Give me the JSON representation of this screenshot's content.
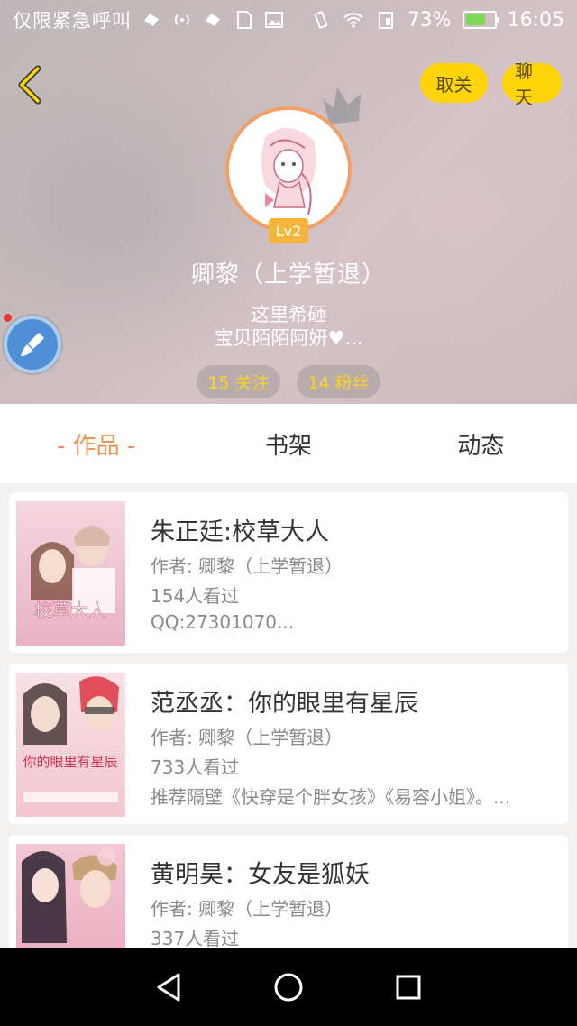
{
  "status_bar": {
    "carrier": "仅限紧急呼叫",
    "battery_percent": "73%",
    "battery_level": 0.73,
    "time": "16:05"
  },
  "header": {
    "back_icon": "chevron-left-icon",
    "unfollow_label": "取关",
    "chat_label": "聊天",
    "level": "Lv2",
    "username": "卿黎（上学暂退）",
    "bio_line1": "这里希砸",
    "bio_line2": "宝贝陌陌阿妍♥...",
    "follow_stat": "15 关注",
    "fans_stat": "14 粉丝"
  },
  "tabs": [
    {
      "label": "- 作品 -",
      "active": true
    },
    {
      "label": "书架",
      "active": false
    },
    {
      "label": "动态",
      "active": false
    }
  ],
  "works": [
    {
      "title": "朱正廷:校草大人",
      "author": "作者: 卿黎（上学暂退）",
      "views": "154人看过",
      "desc": "QQ:27301070...",
      "cover_text": "校草大人"
    },
    {
      "title": "范丞丞：你的眼里有星辰",
      "author": "作者: 卿黎（上学暂退）",
      "views": "733人看过",
      "desc": "推荐隔壁《快穿是个胖女孩》《易容小姐》。...",
      "cover_text": "你的眼里有星辰"
    },
    {
      "title": "黄明昊：女友是狐妖",
      "author": "作者: 卿黎（上学暂退）",
      "views": "337人看过",
      "desc": "",
      "cover_text": ""
    }
  ],
  "colors": {
    "accent": "#f09050",
    "yellow": "#ffd40a",
    "badge": "#f5b53a"
  }
}
